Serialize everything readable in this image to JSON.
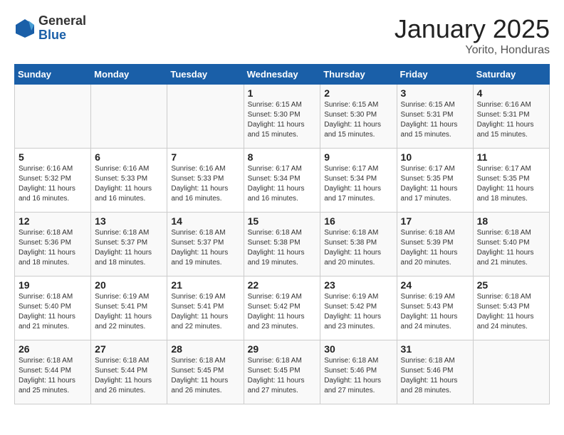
{
  "logo": {
    "general": "General",
    "blue": "Blue"
  },
  "title": "January 2025",
  "location": "Yorito, Honduras",
  "days_of_week": [
    "Sunday",
    "Monday",
    "Tuesday",
    "Wednesday",
    "Thursday",
    "Friday",
    "Saturday"
  ],
  "weeks": [
    [
      {
        "day": "",
        "info": ""
      },
      {
        "day": "",
        "info": ""
      },
      {
        "day": "",
        "info": ""
      },
      {
        "day": "1",
        "info": "Sunrise: 6:15 AM\nSunset: 5:30 PM\nDaylight: 11 hours and 15 minutes."
      },
      {
        "day": "2",
        "info": "Sunrise: 6:15 AM\nSunset: 5:30 PM\nDaylight: 11 hours and 15 minutes."
      },
      {
        "day": "3",
        "info": "Sunrise: 6:15 AM\nSunset: 5:31 PM\nDaylight: 11 hours and 15 minutes."
      },
      {
        "day": "4",
        "info": "Sunrise: 6:16 AM\nSunset: 5:31 PM\nDaylight: 11 hours and 15 minutes."
      }
    ],
    [
      {
        "day": "5",
        "info": "Sunrise: 6:16 AM\nSunset: 5:32 PM\nDaylight: 11 hours and 16 minutes."
      },
      {
        "day": "6",
        "info": "Sunrise: 6:16 AM\nSunset: 5:33 PM\nDaylight: 11 hours and 16 minutes."
      },
      {
        "day": "7",
        "info": "Sunrise: 6:16 AM\nSunset: 5:33 PM\nDaylight: 11 hours and 16 minutes."
      },
      {
        "day": "8",
        "info": "Sunrise: 6:17 AM\nSunset: 5:34 PM\nDaylight: 11 hours and 16 minutes."
      },
      {
        "day": "9",
        "info": "Sunrise: 6:17 AM\nSunset: 5:34 PM\nDaylight: 11 hours and 17 minutes."
      },
      {
        "day": "10",
        "info": "Sunrise: 6:17 AM\nSunset: 5:35 PM\nDaylight: 11 hours and 17 minutes."
      },
      {
        "day": "11",
        "info": "Sunrise: 6:17 AM\nSunset: 5:35 PM\nDaylight: 11 hours and 18 minutes."
      }
    ],
    [
      {
        "day": "12",
        "info": "Sunrise: 6:18 AM\nSunset: 5:36 PM\nDaylight: 11 hours and 18 minutes."
      },
      {
        "day": "13",
        "info": "Sunrise: 6:18 AM\nSunset: 5:37 PM\nDaylight: 11 hours and 18 minutes."
      },
      {
        "day": "14",
        "info": "Sunrise: 6:18 AM\nSunset: 5:37 PM\nDaylight: 11 hours and 19 minutes."
      },
      {
        "day": "15",
        "info": "Sunrise: 6:18 AM\nSunset: 5:38 PM\nDaylight: 11 hours and 19 minutes."
      },
      {
        "day": "16",
        "info": "Sunrise: 6:18 AM\nSunset: 5:38 PM\nDaylight: 11 hours and 20 minutes."
      },
      {
        "day": "17",
        "info": "Sunrise: 6:18 AM\nSunset: 5:39 PM\nDaylight: 11 hours and 20 minutes."
      },
      {
        "day": "18",
        "info": "Sunrise: 6:18 AM\nSunset: 5:40 PM\nDaylight: 11 hours and 21 minutes."
      }
    ],
    [
      {
        "day": "19",
        "info": "Sunrise: 6:18 AM\nSunset: 5:40 PM\nDaylight: 11 hours and 21 minutes."
      },
      {
        "day": "20",
        "info": "Sunrise: 6:19 AM\nSunset: 5:41 PM\nDaylight: 11 hours and 22 minutes."
      },
      {
        "day": "21",
        "info": "Sunrise: 6:19 AM\nSunset: 5:41 PM\nDaylight: 11 hours and 22 minutes."
      },
      {
        "day": "22",
        "info": "Sunrise: 6:19 AM\nSunset: 5:42 PM\nDaylight: 11 hours and 23 minutes."
      },
      {
        "day": "23",
        "info": "Sunrise: 6:19 AM\nSunset: 5:42 PM\nDaylight: 11 hours and 23 minutes."
      },
      {
        "day": "24",
        "info": "Sunrise: 6:19 AM\nSunset: 5:43 PM\nDaylight: 11 hours and 24 minutes."
      },
      {
        "day": "25",
        "info": "Sunrise: 6:18 AM\nSunset: 5:43 PM\nDaylight: 11 hours and 24 minutes."
      }
    ],
    [
      {
        "day": "26",
        "info": "Sunrise: 6:18 AM\nSunset: 5:44 PM\nDaylight: 11 hours and 25 minutes."
      },
      {
        "day": "27",
        "info": "Sunrise: 6:18 AM\nSunset: 5:44 PM\nDaylight: 11 hours and 26 minutes."
      },
      {
        "day": "28",
        "info": "Sunrise: 6:18 AM\nSunset: 5:45 PM\nDaylight: 11 hours and 26 minutes."
      },
      {
        "day": "29",
        "info": "Sunrise: 6:18 AM\nSunset: 5:45 PM\nDaylight: 11 hours and 27 minutes."
      },
      {
        "day": "30",
        "info": "Sunrise: 6:18 AM\nSunset: 5:46 PM\nDaylight: 11 hours and 27 minutes."
      },
      {
        "day": "31",
        "info": "Sunrise: 6:18 AM\nSunset: 5:46 PM\nDaylight: 11 hours and 28 minutes."
      },
      {
        "day": "",
        "info": ""
      }
    ]
  ]
}
